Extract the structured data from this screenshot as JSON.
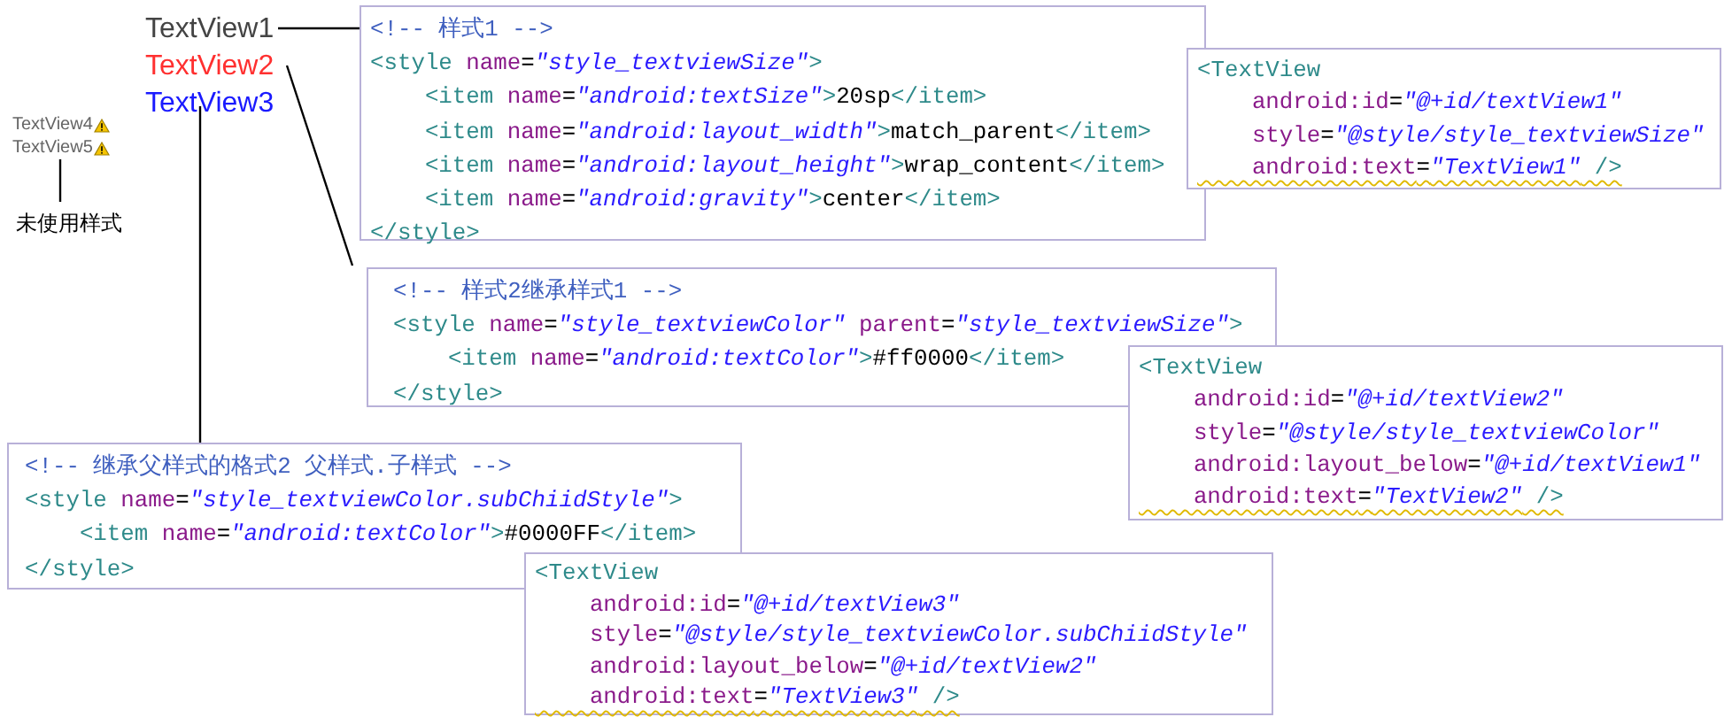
{
  "preview": {
    "styled": [
      {
        "text": "TextView1",
        "color": "#444444"
      },
      {
        "text": "TextView2",
        "color": "#ff3030"
      },
      {
        "text": "TextView3",
        "color": "#1a1aff"
      }
    ],
    "unstyled": [
      {
        "text": "TextView4",
        "warning": true
      },
      {
        "text": "TextView5",
        "warning": true
      }
    ],
    "unstyled_label": "未使用样式"
  },
  "snippets": [
    {
      "lines": [
        {
          "warning": false,
          "tokens": [
            {
              "kind": "comment",
              "text": "<!-- 样式1 -->"
            }
          ]
        },
        {
          "warning": false,
          "tokens": [
            {
              "kind": "tag",
              "text": "<style "
            },
            {
              "kind": "attr",
              "text": "name"
            },
            {
              "kind": "text",
              "text": "="
            },
            {
              "kind": "value",
              "text": "\"style_textviewSize\""
            },
            {
              "kind": "tag",
              "text": ">"
            }
          ]
        },
        {
          "warning": false,
          "tokens": [
            {
              "kind": "tag",
              "text": "    <item "
            },
            {
              "kind": "attr",
              "text": "name"
            },
            {
              "kind": "text",
              "text": "="
            },
            {
              "kind": "value",
              "text": "\"android:textSize\""
            },
            {
              "kind": "tag",
              "text": ">"
            },
            {
              "kind": "text",
              "text": "20sp"
            },
            {
              "kind": "tag",
              "text": "</item>"
            }
          ]
        },
        {
          "warning": false,
          "tokens": [
            {
              "kind": "tag",
              "text": "    <item "
            },
            {
              "kind": "attr",
              "text": "name"
            },
            {
              "kind": "text",
              "text": "="
            },
            {
              "kind": "value",
              "text": "\"android:layout_width\""
            },
            {
              "kind": "tag",
              "text": ">"
            },
            {
              "kind": "text",
              "text": "match_parent"
            },
            {
              "kind": "tag",
              "text": "</item>"
            }
          ]
        },
        {
          "warning": false,
          "tokens": [
            {
              "kind": "tag",
              "text": "    <item "
            },
            {
              "kind": "attr",
              "text": "name"
            },
            {
              "kind": "text",
              "text": "="
            },
            {
              "kind": "value",
              "text": "\"android:layout_height\""
            },
            {
              "kind": "tag",
              "text": ">"
            },
            {
              "kind": "text",
              "text": "wrap_content"
            },
            {
              "kind": "tag",
              "text": "</item>"
            }
          ]
        },
        {
          "warning": false,
          "tokens": [
            {
              "kind": "tag",
              "text": "    <item "
            },
            {
              "kind": "attr",
              "text": "name"
            },
            {
              "kind": "text",
              "text": "="
            },
            {
              "kind": "value",
              "text": "\"android:gravity\""
            },
            {
              "kind": "tag",
              "text": ">"
            },
            {
              "kind": "text",
              "text": "center"
            },
            {
              "kind": "tag",
              "text": "</item>"
            }
          ]
        },
        {
          "warning": false,
          "tokens": [
            {
              "kind": "tag",
              "text": "</style>"
            }
          ]
        }
      ]
    },
    {
      "lines": [
        {
          "warning": false,
          "tokens": [
            {
              "kind": "tag",
              "text": "<TextView"
            }
          ]
        },
        {
          "warning": false,
          "tokens": [
            {
              "kind": "attr",
              "text": "    android:id"
            },
            {
              "kind": "text",
              "text": "="
            },
            {
              "kind": "value",
              "text": "\"@+id/textView1\""
            }
          ]
        },
        {
          "warning": false,
          "tokens": [
            {
              "kind": "attr",
              "text": "    style"
            },
            {
              "kind": "text",
              "text": "="
            },
            {
              "kind": "value",
              "text": "\"@style/style_textviewSize\""
            }
          ]
        },
        {
          "warning": true,
          "tokens": [
            {
              "kind": "attr",
              "text": "    android:text"
            },
            {
              "kind": "text",
              "text": "="
            },
            {
              "kind": "value",
              "text": "\"TextView1\""
            },
            {
              "kind": "tag",
              "text": " />"
            }
          ]
        }
      ]
    },
    {
      "lines": [
        {
          "warning": false,
          "tokens": [
            {
              "kind": "comment",
              "text": "<!-- 样式2继承样式1 -->"
            }
          ]
        },
        {
          "warning": false,
          "tokens": [
            {
              "kind": "tag",
              "text": "<style "
            },
            {
              "kind": "attr",
              "text": "name"
            },
            {
              "kind": "text",
              "text": "="
            },
            {
              "kind": "value",
              "text": "\"style_textviewColor\""
            },
            {
              "kind": "attr",
              "text": " parent"
            },
            {
              "kind": "text",
              "text": "="
            },
            {
              "kind": "value",
              "text": "\"style_textviewSize\""
            },
            {
              "kind": "tag",
              "text": ">"
            }
          ]
        },
        {
          "warning": false,
          "tokens": [
            {
              "kind": "tag",
              "text": "    <item "
            },
            {
              "kind": "attr",
              "text": "name"
            },
            {
              "kind": "text",
              "text": "="
            },
            {
              "kind": "value",
              "text": "\"android:textColor\""
            },
            {
              "kind": "tag",
              "text": ">"
            },
            {
              "kind": "text",
              "text": "#ff0000"
            },
            {
              "kind": "tag",
              "text": "</item>"
            }
          ]
        },
        {
          "warning": false,
          "tokens": [
            {
              "kind": "tag",
              "text": "</style>"
            }
          ]
        }
      ]
    },
    {
      "lines": [
        {
          "warning": false,
          "tokens": [
            {
              "kind": "tag",
              "text": "<TextView"
            }
          ]
        },
        {
          "warning": false,
          "tokens": [
            {
              "kind": "attr",
              "text": "    android:id"
            },
            {
              "kind": "text",
              "text": "="
            },
            {
              "kind": "value",
              "text": "\"@+id/textView2\""
            }
          ]
        },
        {
          "warning": false,
          "tokens": [
            {
              "kind": "attr",
              "text": "    style"
            },
            {
              "kind": "text",
              "text": "="
            },
            {
              "kind": "value",
              "text": "\"@style/style_textviewColor\""
            }
          ]
        },
        {
          "warning": false,
          "tokens": [
            {
              "kind": "attr",
              "text": "    android:layout_below"
            },
            {
              "kind": "text",
              "text": "="
            },
            {
              "kind": "value",
              "text": "\"@+id/textView1\""
            }
          ]
        },
        {
          "warning": true,
          "tokens": [
            {
              "kind": "attr",
              "text": "    android:text"
            },
            {
              "kind": "text",
              "text": "="
            },
            {
              "kind": "value",
              "text": "\"TextView2\""
            },
            {
              "kind": "tag",
              "text": " />"
            }
          ]
        }
      ]
    },
    {
      "lines": [
        {
          "warning": false,
          "tokens": [
            {
              "kind": "comment",
              "text": "<!-- 继承父样式的格式2 父样式.子样式 -->"
            }
          ]
        },
        {
          "warning": false,
          "tokens": [
            {
              "kind": "tag",
              "text": "<style "
            },
            {
              "kind": "attr",
              "text": "name"
            },
            {
              "kind": "text",
              "text": "="
            },
            {
              "kind": "value",
              "text": "\"style_textviewColor.subChiidStyle\""
            },
            {
              "kind": "tag",
              "text": ">"
            }
          ]
        },
        {
          "warning": false,
          "tokens": [
            {
              "kind": "tag",
              "text": "    <item "
            },
            {
              "kind": "attr",
              "text": "name"
            },
            {
              "kind": "text",
              "text": "="
            },
            {
              "kind": "value",
              "text": "\"android:textColor\""
            },
            {
              "kind": "tag",
              "text": ">"
            },
            {
              "kind": "text",
              "text": "#0000FF"
            },
            {
              "kind": "tag",
              "text": "</item>"
            }
          ]
        },
        {
          "warning": false,
          "tokens": [
            {
              "kind": "tag",
              "text": "</style>"
            }
          ]
        }
      ]
    },
    {
      "lines": [
        {
          "warning": false,
          "tokens": [
            {
              "kind": "tag",
              "text": "<TextView"
            }
          ]
        },
        {
          "warning": false,
          "tokens": [
            {
              "kind": "attr",
              "text": "    android:id"
            },
            {
              "kind": "text",
              "text": "="
            },
            {
              "kind": "value",
              "text": "\"@+id/textView3\""
            }
          ]
        },
        {
          "warning": false,
          "tokens": [
            {
              "kind": "attr",
              "text": "    style"
            },
            {
              "kind": "text",
              "text": "="
            },
            {
              "kind": "value",
              "text": "\"@style/style_textviewColor.subChiidStyle\""
            }
          ]
        },
        {
          "warning": false,
          "tokens": [
            {
              "kind": "attr",
              "text": "    android:layout_below"
            },
            {
              "kind": "text",
              "text": "="
            },
            {
              "kind": "value",
              "text": "\"@+id/textView2\""
            }
          ]
        },
        {
          "warning": true,
          "tokens": [
            {
              "kind": "attr",
              "text": "    android:text"
            },
            {
              "kind": "text",
              "text": "="
            },
            {
              "kind": "value",
              "text": "\"TextView3\""
            },
            {
              "kind": "tag",
              "text": " />"
            }
          ]
        }
      ]
    }
  ]
}
